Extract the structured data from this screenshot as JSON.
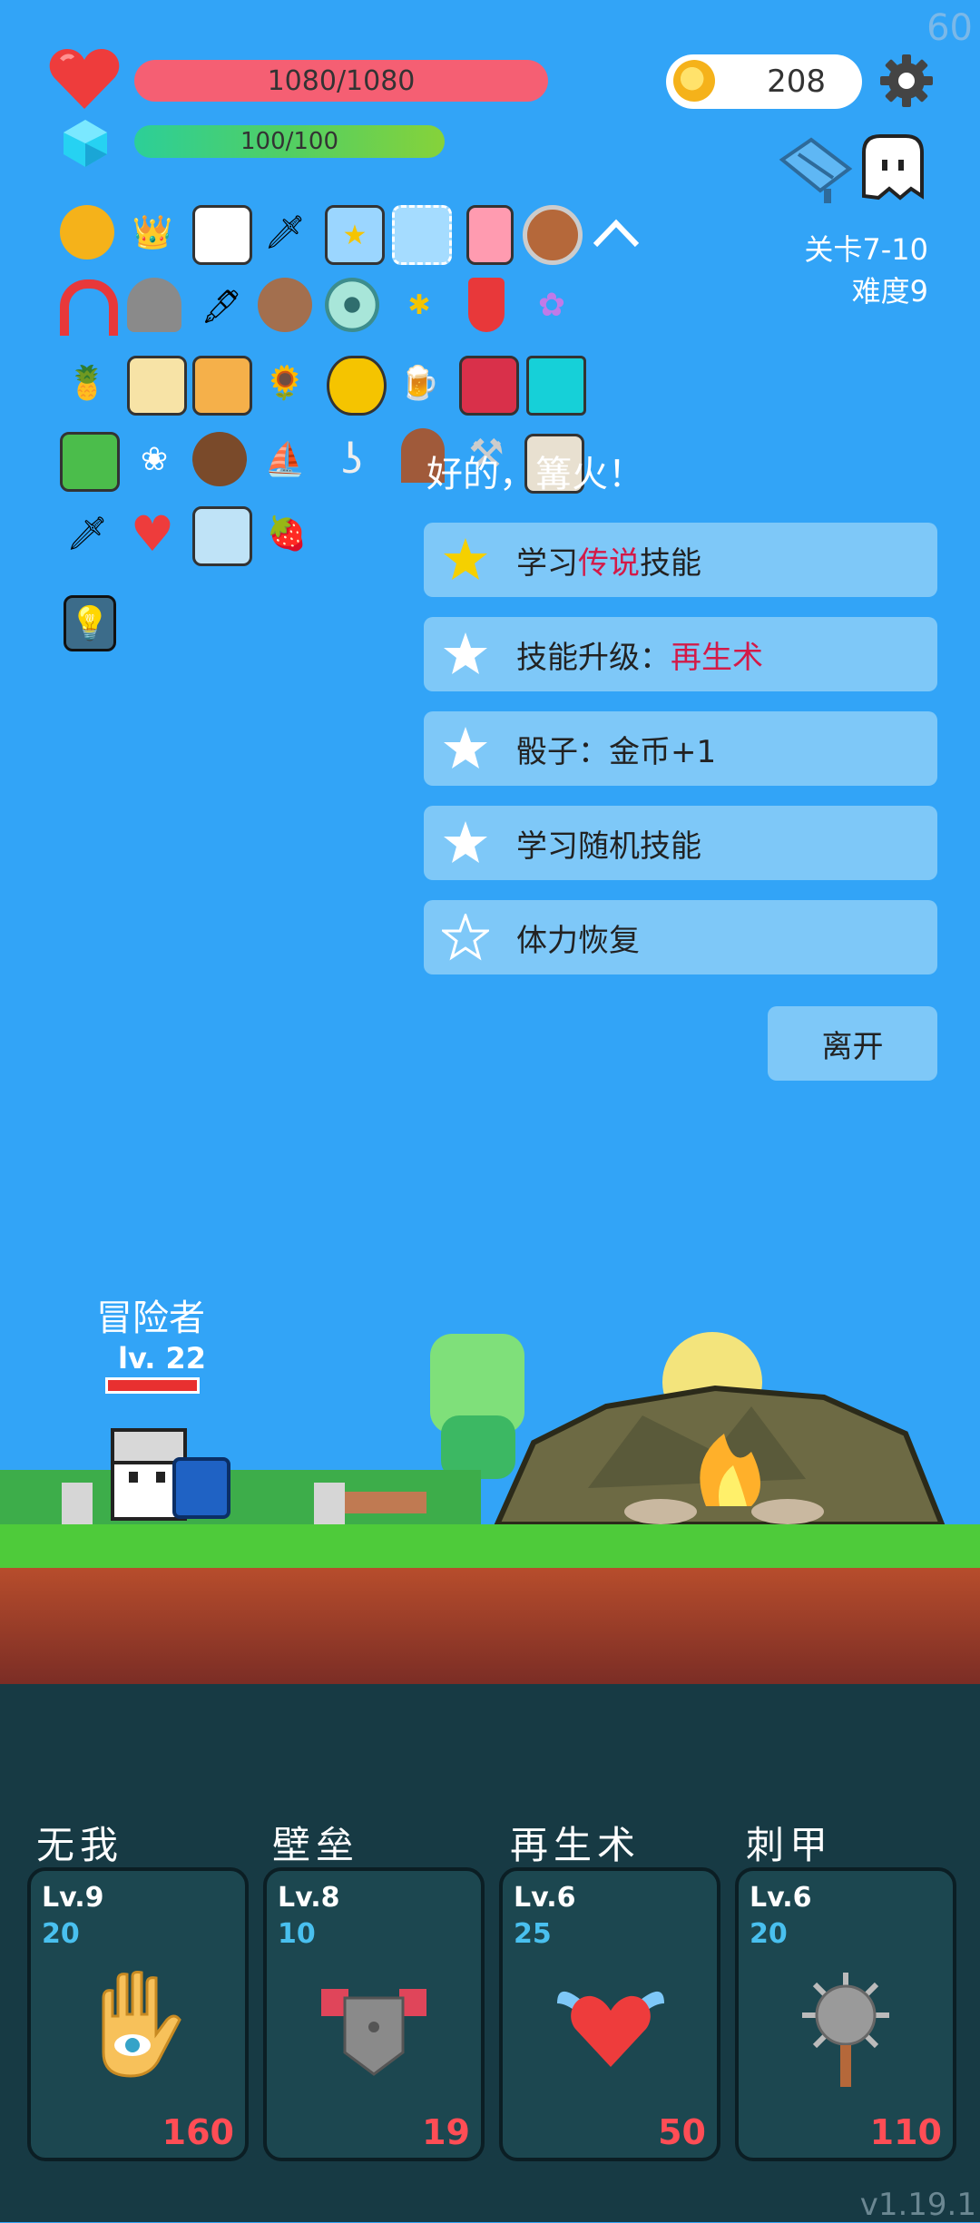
{
  "fps": "60",
  "hp": "1080/1080",
  "mp": "100/100",
  "coins": "208",
  "stage": {
    "level": "关卡7-10",
    "difficulty": "难度9"
  },
  "message": "好的，篝火！",
  "options": [
    {
      "pre": "学习",
      "hl": "传说",
      "post": "技能"
    },
    {
      "pre": "技能升级：",
      "hl": "再生术",
      "post": ""
    },
    {
      "pre": "骰子：金币+1",
      "hl": "",
      "post": ""
    },
    {
      "pre": "学习随机技能",
      "hl": "",
      "post": ""
    },
    {
      "pre": "体力恢复",
      "hl": "",
      "post": ""
    }
  ],
  "leave": "离开",
  "hero": {
    "name": "冒险者",
    "level": "lv. 22"
  },
  "skills": [
    {
      "name": "无我",
      "lv": "Lv.9",
      "cost": "20",
      "value": "160"
    },
    {
      "name": "壁垒",
      "lv": "Lv.8",
      "cost": "10",
      "value": "19"
    },
    {
      "name": "再生术",
      "lv": "Lv.6",
      "cost": "25",
      "value": "50"
    },
    {
      "name": "刺甲",
      "lv": "Lv.6",
      "cost": "20",
      "value": "110"
    }
  ],
  "version": "v1.19.1",
  "colors": {
    "sky": "#32a4f7",
    "hp": "#f55f73",
    "highlight": "#d31a48",
    "panel": "#173a44"
  }
}
